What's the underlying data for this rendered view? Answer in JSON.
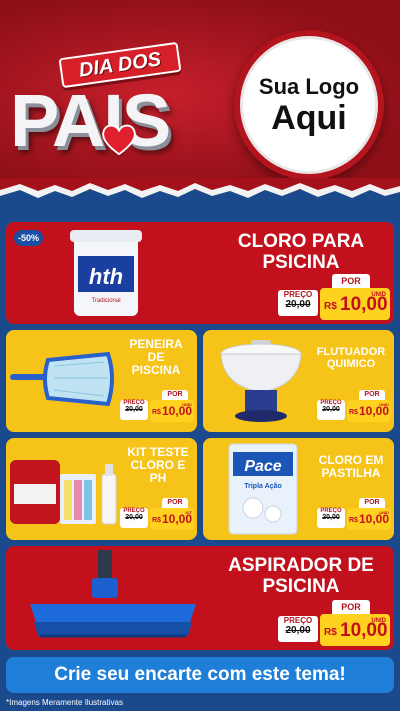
{
  "header": {
    "brand_line1": "DIA DOS",
    "brand_line2": "PAIS",
    "logo_line1": "Sua Logo",
    "logo_line2": "Aqui"
  },
  "products": [
    {
      "name_l1": "CLORO PARA",
      "name_l2": "PSICINA",
      "name_l3": "",
      "badge": "-50%",
      "preco_label": "PREÇO",
      "old_price": "20,00",
      "por_label": "POR",
      "currency": "R$",
      "price": "10,00",
      "unit": "UNID"
    },
    {
      "name_l1": "PENEIRA",
      "name_l2": "DE",
      "name_l3": "PISCINA",
      "preco_label": "PREÇO",
      "old_price": "20,00",
      "por_label": "POR",
      "currency": "R$",
      "price": "10,00",
      "unit": "UNID"
    },
    {
      "name_l1": "FLUTUADOR",
      "name_l2": "QUIMICO",
      "name_l3": "",
      "preco_label": "PREÇO",
      "old_price": "20,00",
      "por_label": "POR",
      "currency": "R$",
      "price": "10,00",
      "unit": "UNID"
    },
    {
      "name_l1": "KIT TESTE",
      "name_l2": "CLORO E",
      "name_l3": "PH",
      "preco_label": "PREÇO",
      "old_price": "20,00",
      "por_label": "POR",
      "currency": "R$",
      "price": "10,00",
      "unit": "KIT"
    },
    {
      "name_l1": "CLORO EM",
      "name_l2": "PASTILHA",
      "name_l3": "",
      "preco_label": "PREÇO",
      "old_price": "20,00",
      "por_label": "POR",
      "currency": "R$",
      "price": "10,00",
      "unit": "UNID"
    },
    {
      "name_l1": "ASPIRADOR DE",
      "name_l2": "PSICINA",
      "name_l3": "",
      "preco_label": "PREÇO",
      "old_price": "20,00",
      "por_label": "POR",
      "currency": "R$",
      "price": "10,00",
      "unit": "UNID"
    }
  ],
  "product_images": {
    "bucket_brand": "hth",
    "bucket_label": "Tradicional",
    "pack_brand": "Pace",
    "pack_subtitle": "Tripla Ação"
  },
  "cta": "Crie seu encarte com este tema!",
  "footnote": "*Imagens Meramente Ilustrativas",
  "colors": {
    "red": "#c2111d",
    "yellow": "#f6c318",
    "blue": "#1b4a8c",
    "cta": "#1f7fd8"
  }
}
